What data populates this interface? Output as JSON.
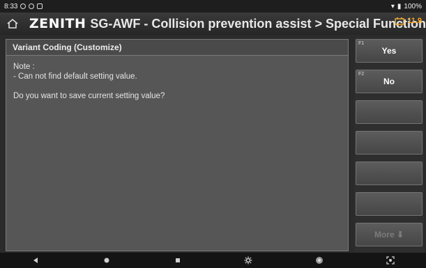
{
  "status_bar": {
    "time": "8:33",
    "battery": "100%"
  },
  "header": {
    "brand": "ZENITH",
    "title": "SG-AWF - Collision prevention assist > Special Function",
    "voltage": "11.9"
  },
  "panel": {
    "title": "Variant Coding (Customize)",
    "note_label": "Note :",
    "note_text": "- Can not find default setting value.",
    "question": "Do you want to save current setting value?"
  },
  "function_keys": [
    {
      "id": "F1",
      "label": "Yes"
    },
    {
      "id": "F2",
      "label": "No"
    },
    {
      "id": "",
      "label": ""
    },
    {
      "id": "",
      "label": ""
    },
    {
      "id": "",
      "label": ""
    },
    {
      "id": "",
      "label": ""
    },
    {
      "id": "",
      "label": "More"
    }
  ],
  "colors": {
    "accent": "#f5a623",
    "panel_bg": "#565656"
  },
  "nav_icons": [
    "back-icon",
    "home-circle-icon",
    "recents-icon",
    "settings-icon",
    "chrome-icon",
    "screenshot-icon"
  ]
}
